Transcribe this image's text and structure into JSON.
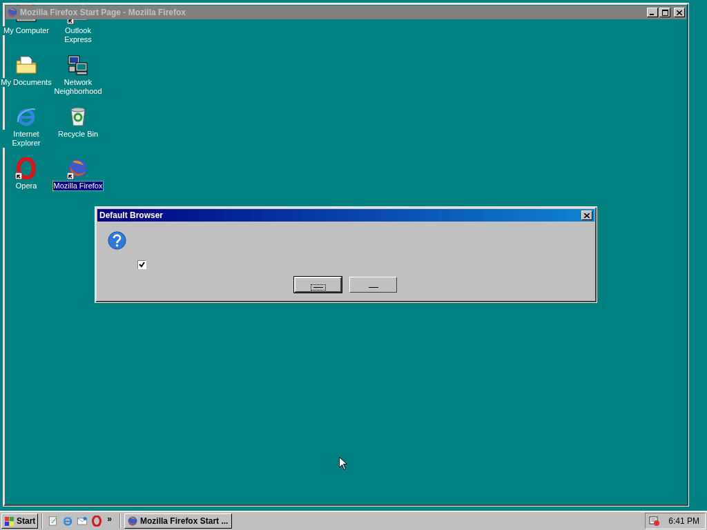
{
  "firefox_window": {
    "title": "Mozilla Firefox Start Page - Mozilla Firefox",
    "active": false
  },
  "desktop_icons": [
    {
      "label": "My Computer",
      "kind": "computer",
      "selected": false,
      "shortcut": false
    },
    {
      "label": "Outlook Express",
      "kind": "outlook",
      "selected": false,
      "shortcut": true
    },
    {
      "label": "My Documents",
      "kind": "folder",
      "selected": false,
      "shortcut": false
    },
    {
      "label": "Network Neighborhood",
      "kind": "network",
      "selected": false,
      "shortcut": false
    },
    {
      "label": "Internet Explorer",
      "kind": "ie",
      "selected": false,
      "shortcut": false
    },
    {
      "label": "Recycle Bin",
      "kind": "recycle",
      "selected": false,
      "shortcut": false
    },
    {
      "label": "Opera",
      "kind": "opera",
      "selected": false,
      "shortcut": true
    },
    {
      "label": "Mozilla Firefox",
      "kind": "firefox",
      "selected": true,
      "shortcut": true
    }
  ],
  "dialog": {
    "title": "Default Browser",
    "checkbox": {
      "checked": true
    },
    "buttons": [
      {
        "default": true
      },
      {
        "default": false
      }
    ]
  },
  "taskbar": {
    "start": "Start",
    "quick_launch": [
      {
        "kind": "notepad"
      },
      {
        "kind": "ie"
      },
      {
        "kind": "outlook"
      },
      {
        "kind": "opera"
      }
    ],
    "chevron": "»",
    "tasks": [
      {
        "label": "Mozilla Firefox Start ...",
        "selected": false
      }
    ],
    "clock": "6:41 PM"
  }
}
